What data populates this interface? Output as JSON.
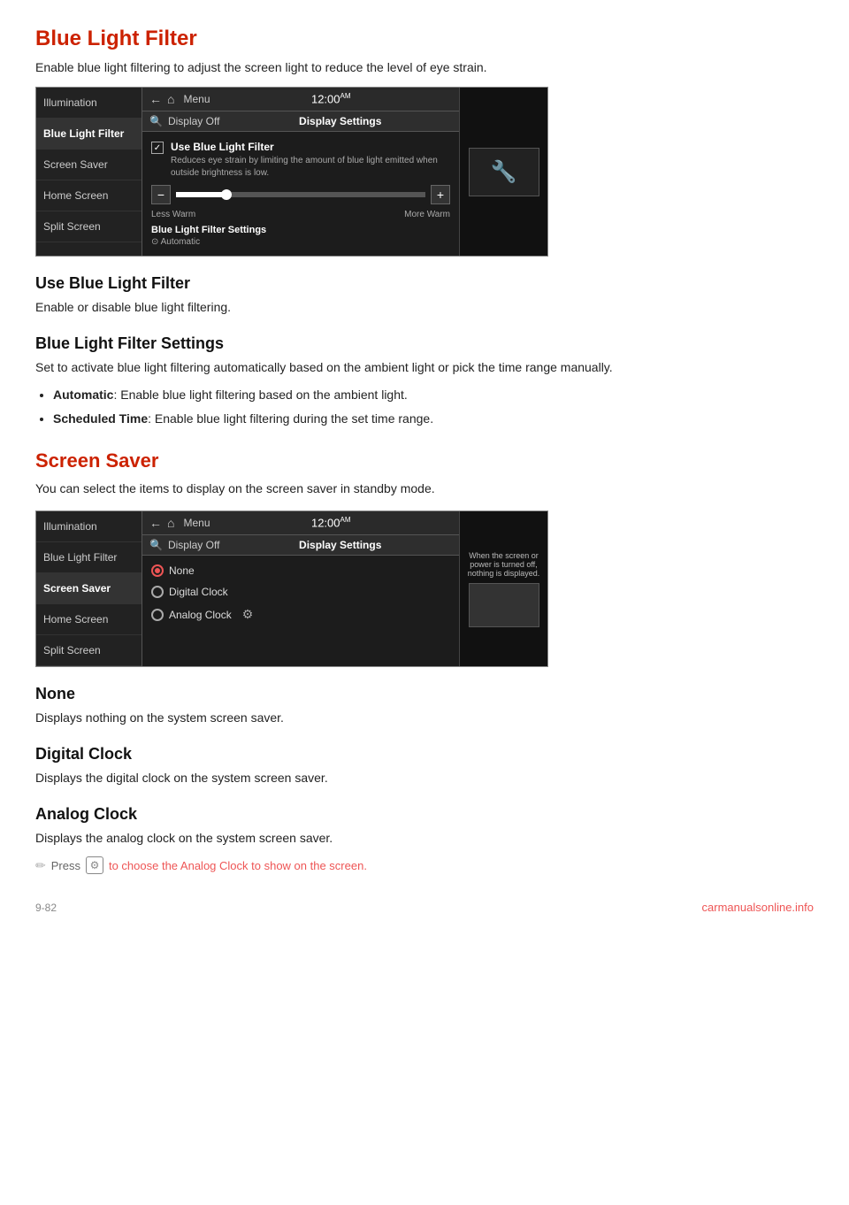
{
  "page": {
    "title_blue_light": "Blue Light Filter",
    "desc_blue_light": "Enable blue light filtering to adjust the screen light to reduce the level of eye strain.",
    "ui1": {
      "topbar": {
        "back_icon": "←",
        "home_icon": "⌂",
        "menu_label": "Menu",
        "time": "12:00",
        "time_suffix": "AM"
      },
      "statusbar": {
        "search_icon": "🔍",
        "display_off": "Display Off",
        "title": "Display Settings"
      },
      "sidebar": {
        "items": [
          "Illumination",
          "Blue Light Filter",
          "Screen Saver",
          "Home Screen",
          "Split Screen"
        ]
      },
      "content": {
        "checkbox_checked": "✓",
        "main_label": "Use Blue Light Filter",
        "sub_label": "Reduces eye strain by limiting the amount of blue light emitted when outside brightness is low.",
        "slider_minus": "−",
        "slider_plus": "+",
        "label_less": "Less Warm",
        "label_more": "More Warm",
        "settings_label": "Blue Light Filter Settings",
        "auto_label": "⊙ Automatic"
      }
    },
    "section_use_title": "Use Blue Light Filter",
    "section_use_desc": "Enable or disable blue light filtering.",
    "section_settings_title": "Blue Light Filter Settings",
    "section_settings_desc": "Set to activate blue light filtering automatically based on the ambient light or pick the time range manually.",
    "bullet_automatic": "Automatic",
    "bullet_automatic_desc": ": Enable blue light filtering based on the ambient light.",
    "bullet_scheduled": "Scheduled Time",
    "bullet_scheduled_desc": ": Enable blue light filtering during the set time range.",
    "section_screensaver_title": "Screen Saver",
    "section_screensaver_desc": "You can select the items to display on the screen saver in standby mode.",
    "ui2": {
      "topbar": {
        "back_icon": "←",
        "home_icon": "⌂",
        "menu_label": "Menu",
        "time": "12:00",
        "time_suffix": "AM"
      },
      "statusbar": {
        "search_icon": "🔍",
        "display_off": "Display Off",
        "title": "Display Settings"
      },
      "sidebar": {
        "items": [
          "Illumination",
          "Blue Light Filter",
          "Screen Saver",
          "Home Screen",
          "Split Screen"
        ]
      },
      "content": {
        "option_none": "None",
        "option_digital": "Digital Clock",
        "option_analog": "Analog Clock"
      },
      "side_note": "When the screen or power is turned off, nothing is displayed."
    },
    "section_none_title": "None",
    "section_none_desc": "Displays nothing on the system screen saver.",
    "section_digital_title": "Digital Clock",
    "section_digital_desc": "Displays the digital clock on the system screen saver.",
    "section_analog_title": "Analog Clock",
    "section_analog_desc": "Displays the analog clock on the system screen saver.",
    "note_text": "Press",
    "note_suffix": "to choose the Analog Clock to show on the screen.",
    "footer_page": "9-82",
    "footer_logo": "carmanualsonline.info"
  }
}
